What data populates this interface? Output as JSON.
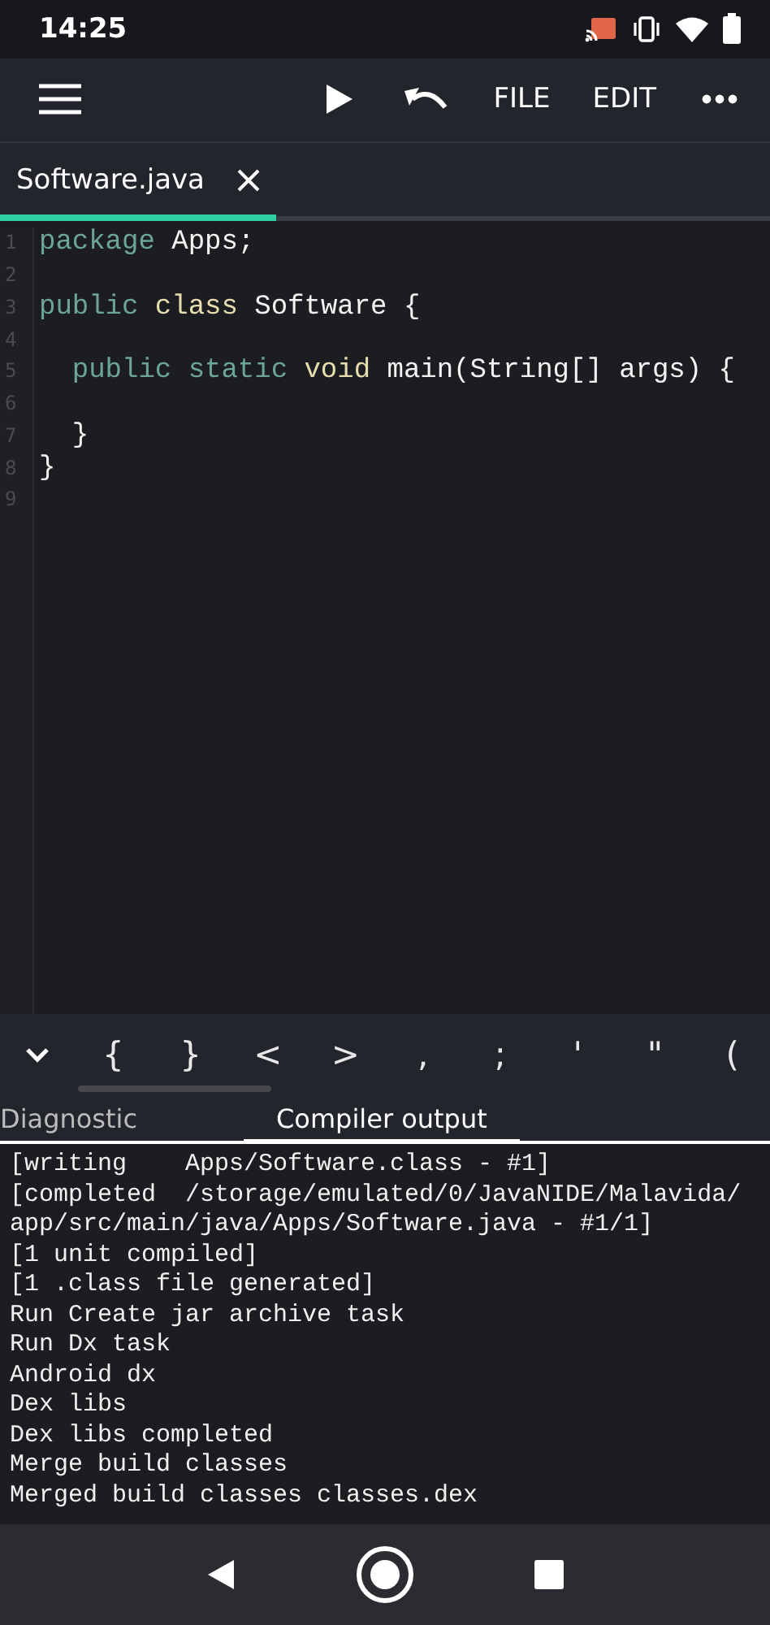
{
  "status_bar": {
    "time": "14:25"
  },
  "toolbar": {
    "actions": [
      {
        "kind": "run"
      },
      {
        "kind": "undo"
      },
      {
        "kind": "text",
        "label": "FILE"
      },
      {
        "kind": "text",
        "label": "EDIT"
      },
      {
        "kind": "more"
      }
    ]
  },
  "tabs": [
    {
      "label": "Software.java",
      "selected": true
    }
  ],
  "editor": {
    "lines": [
      {
        "number": "1",
        "tokens": [
          {
            "kind": "keyword",
            "text": "package"
          },
          {
            "kind": "plain",
            "text": " Apps;"
          }
        ]
      },
      {
        "number": "2"
      },
      {
        "number": "3",
        "tokens": [
          {
            "kind": "keyword",
            "text": "public"
          },
          {
            "kind": "type",
            "text": " class"
          },
          {
            "kind": "plain",
            "text": " Software {"
          }
        ]
      },
      {
        "number": "4"
      },
      {
        "number": "5",
        "tokens": [
          {
            "kind": "keyword",
            "text": "  public static"
          },
          {
            "kind": "type",
            "text": " void"
          },
          {
            "kind": "plain",
            "text": " main(String[] args) {"
          }
        ]
      },
      {
        "number": "6"
      },
      {
        "number": "7",
        "tokens": [
          {
            "kind": "plain",
            "text": "  }"
          }
        ]
      },
      {
        "number": "8",
        "tokens": [
          {
            "kind": "plain",
            "text": "}"
          }
        ]
      },
      {
        "number": "9"
      }
    ]
  },
  "symbol_bar": {
    "keys": [
      "{",
      "}",
      "<",
      ">",
      ",",
      ";",
      "'",
      "\"",
      "("
    ]
  },
  "output_tabs": [
    {
      "label": "Diagnostic",
      "selected": false
    },
    {
      "label": "Compiler output",
      "selected": true
    }
  ],
  "output_lines": [
    "[writing    Apps/Software.class - #1]",
    "[completed  /storage/emulated/0/JavaNIDE/Malavida/app/src/main/java/Apps/Software.java - #1/1]",
    "[1 unit compiled]",
    "[1 .class file generated]",
    "Run Create jar archive task",
    "Run Dx task",
    "Android dx",
    "Dex libs",
    "Dex libs completed",
    "Merge build classes",
    "Merged build classes classes.dex"
  ]
}
